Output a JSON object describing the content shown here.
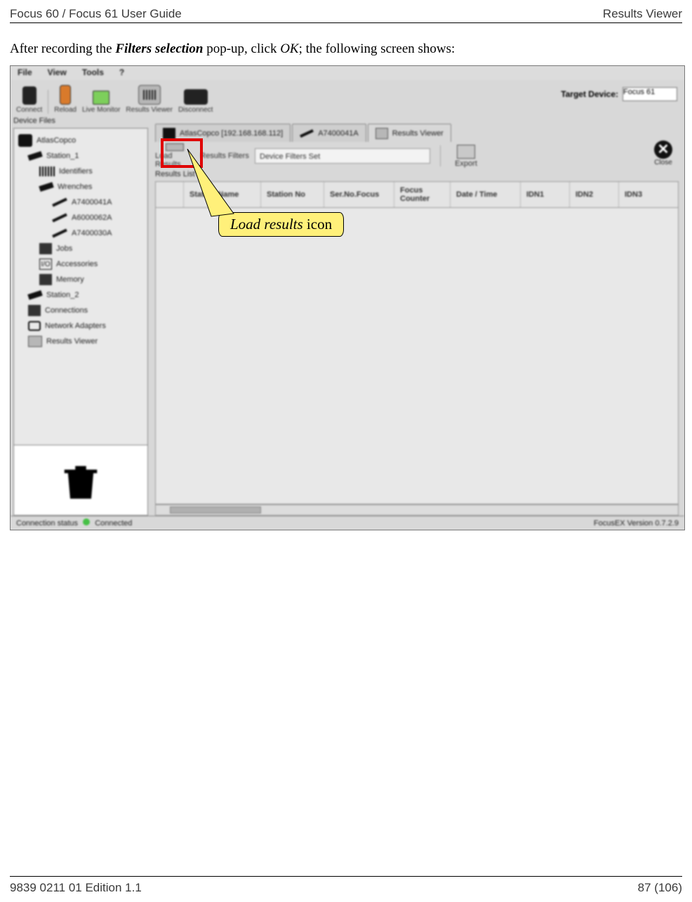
{
  "header": {
    "left": "Focus 60 / Focus 61 User Guide",
    "right": "Results Viewer"
  },
  "instruction": {
    "pre": "After recording the ",
    "bold_italic": "Filters selection",
    "mid": " pop-up, click ",
    "italic": "OK",
    "post": "; the following screen shows:"
  },
  "menubar": {
    "file": "File",
    "view": "View",
    "tools": "Tools",
    "help": "?"
  },
  "toolbar": {
    "connect": "Connect",
    "reload": "Reload",
    "live_monitor": "Live Monitor",
    "results_viewer": "Results Viewer",
    "disconnect": "Disconnect",
    "target_device_label": "Target Device:",
    "target_device_value": "Focus 61"
  },
  "sidebar_title": "Device Files",
  "tree": {
    "root": "AtlasCopco",
    "station1": "Station_1",
    "identifiers": "Identifiers",
    "wrenches": "Wrenches",
    "wrench_items": [
      "A7400041A",
      "A6000062A",
      "A7400030A"
    ],
    "jobs": "Jobs",
    "accessories": "Accessories",
    "memory": "Memory",
    "station2": "Station_2",
    "connections": "Connections",
    "network_adapters": "Network Adapters",
    "results_viewer": "Results Viewer"
  },
  "tabs": {
    "t1": "AtlasCopco [192.168.168.112]",
    "t2": "A7400041A",
    "t3": "Results Viewer"
  },
  "subbar": {
    "load_results": "Load Results",
    "results_filters": "Results Filters",
    "device_filters_set": "Device Filters Set",
    "export": "Export",
    "close": "Close"
  },
  "results_list_label": "Results List",
  "columns": {
    "station_name": "Station Name",
    "station_no": "Station No",
    "ser_no_focus": "Ser.No.Focus",
    "focus_counter": "Focus Counter",
    "date_time": "Date / Time",
    "idn1": "IDN1",
    "idn2": "IDN2",
    "idn3": "IDN3"
  },
  "status": {
    "left_label": "Connection status",
    "left_value": "Connected",
    "right": "FocusEX Version 0.7.2.9"
  },
  "callout": {
    "italic": "Load results",
    "rest": " icon"
  },
  "footer": {
    "left": "9839 0211 01 Edition 1.1",
    "right": "87 (106)"
  }
}
